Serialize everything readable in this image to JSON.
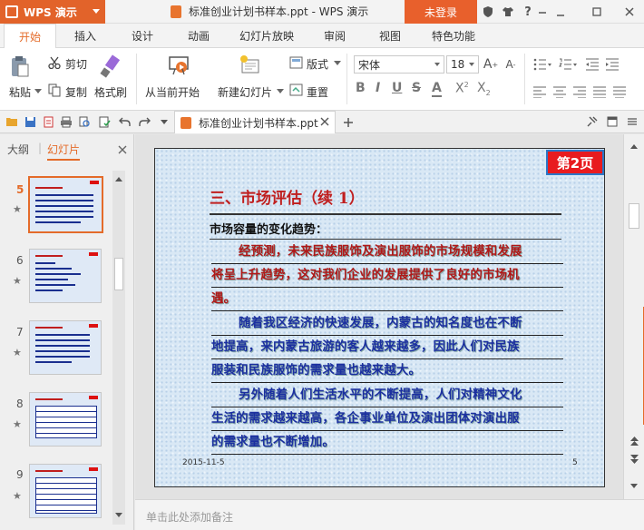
{
  "titlebar": {
    "app_name": "WPS 演示",
    "document_title": "标准创业计划书样本.ppt - WPS 演示",
    "login_label": "未登录",
    "icons": [
      "shield-icon",
      "shirt-icon",
      "help-icon",
      "minimize-icon",
      "restore-icon",
      "close-icon"
    ]
  },
  "tabs": [
    "开始",
    "插入",
    "设计",
    "动画",
    "幻灯片放映",
    "审阅",
    "视图",
    "特色功能"
  ],
  "ribbon": {
    "cut": "剪切",
    "paste": "粘贴",
    "copy": "复制",
    "format_painter": "格式刷",
    "from_current": "从当前开始",
    "new_slide": "新建幻灯片",
    "layout": "版式",
    "reset": "重置",
    "font_name": "宋体",
    "font_size": "18"
  },
  "document_tab": {
    "label": "标准创业计划书样本.ppt"
  },
  "sidebar": {
    "tab_outline": "大纲",
    "tab_slides": "幻灯片",
    "slides": [
      {
        "number": "5",
        "selected": true
      },
      {
        "number": "6",
        "selected": false
      },
      {
        "number": "7",
        "selected": false
      },
      {
        "number": "8",
        "selected": false
      },
      {
        "number": "9",
        "selected": false
      }
    ]
  },
  "slide": {
    "page_badge": "第2页",
    "title": "三、市场评估（续 1）",
    "subheading": "市场容量的变化趋势：",
    "para1": [
      "经预测，未来民族服饰及演出服饰的市场规模和发展",
      "将呈上升趋势，这对我们企业的发展提供了良好的市场机",
      "遇。"
    ],
    "para2": [
      "随着我区经济的快速发展，内蒙古的知名度也在不断",
      "地提高，来内蒙古旅游的客人越来越多，因此人们对民族",
      "服装和民族服饰的需求量也越来越大。"
    ],
    "para3": [
      "另外随着人们生活水平的不断提高，人们对精神文化",
      "生活的需求越来越高，各企事业单位及演出团体对演出服",
      "的需求量也不断增加。"
    ],
    "footer_date": "2015-11-5",
    "footer_number": "5"
  },
  "notes_placeholder": "单击此处添加备注",
  "colors": {
    "accent": "#e46b29",
    "slide_title": "#c01e1e",
    "slide_blue": "#1b2fa0",
    "badge": "#e81b1f"
  }
}
